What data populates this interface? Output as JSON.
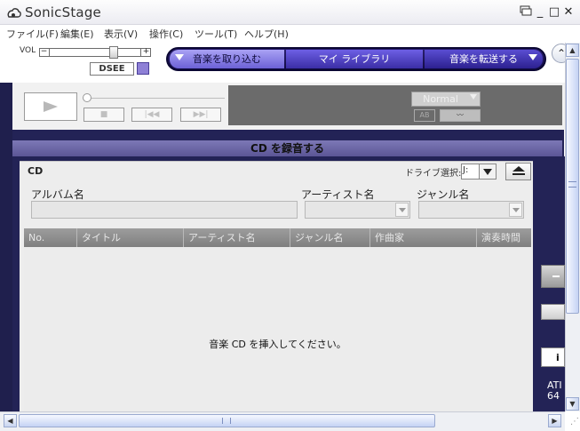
{
  "window": {
    "title": "SonicStage",
    "restore_icon": "restore-icon",
    "minimize_glyph": "_",
    "maximize_glyph": "□",
    "close_glyph": "✕"
  },
  "menu": [
    "ファイル(F)",
    "編集(E)",
    "表示(V)",
    "操作(C)",
    "ツール(T)",
    "ヘルプ(H)"
  ],
  "volume": {
    "label": "VOL",
    "minus": "−",
    "plus": "+",
    "level": 0.6
  },
  "dsee": {
    "label": "DSEE"
  },
  "tabs": [
    {
      "label": "音楽を取り込む",
      "selected": true
    },
    {
      "label": "マイ ライブラリ",
      "selected": false
    },
    {
      "label": "音楽を転送する",
      "selected": false
    }
  ],
  "up_glyph": "⌃",
  "player": {
    "play_icon": "play-icon",
    "stop_glyph": "■",
    "prev_glyph": "|◀◀",
    "next_glyph": "▶▶|",
    "mode": "Normal",
    "mode_icon1": "AB",
    "mode_icon2": "〰"
  },
  "section": {
    "title": "CD を録音する"
  },
  "cd_panel": {
    "label": "CD",
    "drive_label": "ドライブ選択:",
    "drive_value": "J:",
    "album_label": "アルバム名",
    "artist_label": "アーティスト名",
    "genre_label": "ジャンル名"
  },
  "table": {
    "columns": [
      "No.",
      "タイトル",
      "アーティスト名",
      "ジャンル名",
      "作曲家",
      "演奏時間"
    ],
    "empty_message": "音楽 CD を挿入してください。"
  },
  "side": {
    "btn3_glyph": "i",
    "text1": "ATI",
    "text2": "64"
  },
  "scroll": {
    "up": "▲",
    "down": "▼",
    "left": "◀",
    "right": "▶",
    "grip": "⋰"
  },
  "colors": {
    "dark_frame": "#232356",
    "tab_selected": "#a9a2f4",
    "header_gray": "#8a8a8a"
  }
}
